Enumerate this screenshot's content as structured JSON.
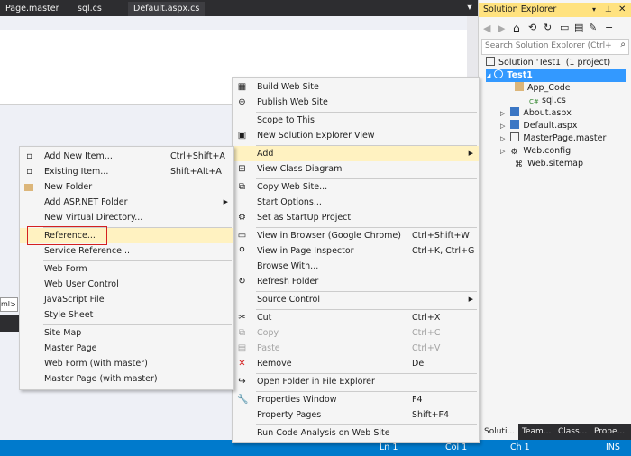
{
  "editor_tabs": [
    "Page.master",
    "sql.cs",
    "Default.aspx.cs"
  ],
  "solution_explorer": {
    "title": "Solution Explorer",
    "search_placeholder": "Search Solution Explorer (Ctrl+;)",
    "tree": [
      {
        "label": "Solution 'Test1' (1 project)",
        "icon": "solution-icon"
      },
      {
        "label": "Test1",
        "icon": "web-project-icon"
      },
      {
        "label": "App_Code",
        "icon": "folder-icon"
      },
      {
        "label": "sql.cs",
        "icon": "csharp-file-icon"
      },
      {
        "label": "About.aspx",
        "icon": "aspx-file-icon"
      },
      {
        "label": "Default.aspx",
        "icon": "aspx-file-icon"
      },
      {
        "label": "MasterPage.master",
        "icon": "master-file-icon"
      },
      {
        "label": "Web.config",
        "icon": "config-file-icon"
      },
      {
        "label": "Web.sitemap",
        "icon": "sitemap-file-icon"
      }
    ],
    "bottom_tabs": [
      "Soluti...",
      "Team...",
      "Class...",
      "Prope..."
    ]
  },
  "designer_tag": "ml>",
  "status_bar": {
    "ln": "Ln 1",
    "col": "Col 1",
    "ch": "Ch 1",
    "mode": "INS"
  },
  "context_menu": [
    {
      "label": "Build Web Site",
      "shortcut": "",
      "icon": "build-icon"
    },
    {
      "label": "Publish Web Site",
      "shortcut": "",
      "icon": "publish-icon"
    },
    {
      "label": "Scope to This",
      "shortcut": "",
      "icon": ""
    },
    {
      "label": "New Solution Explorer View",
      "shortcut": "",
      "icon": "new-view-icon"
    },
    {
      "label": "Add",
      "shortcut": "",
      "icon": ""
    },
    {
      "label": "View Class Diagram",
      "shortcut": "",
      "icon": "class-diagram-icon"
    },
    {
      "label": "Copy Web Site...",
      "shortcut": "",
      "icon": "copy-web-icon"
    },
    {
      "label": "Start Options...",
      "shortcut": "",
      "icon": ""
    },
    {
      "label": "Set as StartUp Project",
      "shortcut": "",
      "icon": "gear-icon"
    },
    {
      "label": "View in Browser (Google Chrome)",
      "shortcut": "Ctrl+Shift+W",
      "icon": "browser-icon"
    },
    {
      "label": "View in Page Inspector",
      "shortcut": "Ctrl+K, Ctrl+G",
      "icon": "inspector-icon"
    },
    {
      "label": "Browse With...",
      "shortcut": "",
      "icon": ""
    },
    {
      "label": "Refresh Folder",
      "shortcut": "",
      "icon": "refresh-icon"
    },
    {
      "label": "Source Control",
      "shortcut": "",
      "icon": ""
    },
    {
      "label": "Cut",
      "shortcut": "Ctrl+X",
      "icon": "cut-icon"
    },
    {
      "label": "Copy",
      "shortcut": "Ctrl+C",
      "icon": "copy-icon"
    },
    {
      "label": "Paste",
      "shortcut": "Ctrl+V",
      "icon": "paste-icon"
    },
    {
      "label": "Remove",
      "shortcut": "Del",
      "icon": "remove-icon"
    },
    {
      "label": "Open Folder in File Explorer",
      "shortcut": "",
      "icon": "open-folder-icon"
    },
    {
      "label": "Properties Window",
      "shortcut": "F4",
      "icon": "wrench-icon"
    },
    {
      "label": "Property Pages",
      "shortcut": "Shift+F4",
      "icon": ""
    },
    {
      "label": "Run Code Analysis on Web Site",
      "shortcut": "",
      "icon": ""
    }
  ],
  "add_submenu": [
    {
      "label": "Add New Item...",
      "shortcut": "Ctrl+Shift+A",
      "icon": "new-item-icon"
    },
    {
      "label": "Existing Item...",
      "shortcut": "Shift+Alt+A",
      "icon": "existing-item-icon"
    },
    {
      "label": "New Folder",
      "shortcut": "",
      "icon": "folder-icon"
    },
    {
      "label": "Add ASP.NET Folder",
      "shortcut": "",
      "icon": ""
    },
    {
      "label": "New Virtual Directory...",
      "shortcut": "",
      "icon": ""
    },
    {
      "label": "Reference...",
      "shortcut": "",
      "icon": ""
    },
    {
      "label": "Service Reference...",
      "shortcut": "",
      "icon": ""
    },
    {
      "label": "Web Form",
      "shortcut": "",
      "icon": ""
    },
    {
      "label": "Web User Control",
      "shortcut": "",
      "icon": ""
    },
    {
      "label": "JavaScript File",
      "shortcut": "",
      "icon": ""
    },
    {
      "label": "Style Sheet",
      "shortcut": "",
      "icon": ""
    },
    {
      "label": "Site Map",
      "shortcut": "",
      "icon": ""
    },
    {
      "label": "Master Page",
      "shortcut": "",
      "icon": ""
    },
    {
      "label": "Web Form (with master)",
      "shortcut": "",
      "icon": ""
    },
    {
      "label": "Master Page (with master)",
      "shortcut": "",
      "icon": ""
    }
  ],
  "colors": {
    "accent": "#007acc",
    "highlight": "#fff2c1",
    "title_active": "#ffe27f",
    "red_box": "#d42020"
  }
}
